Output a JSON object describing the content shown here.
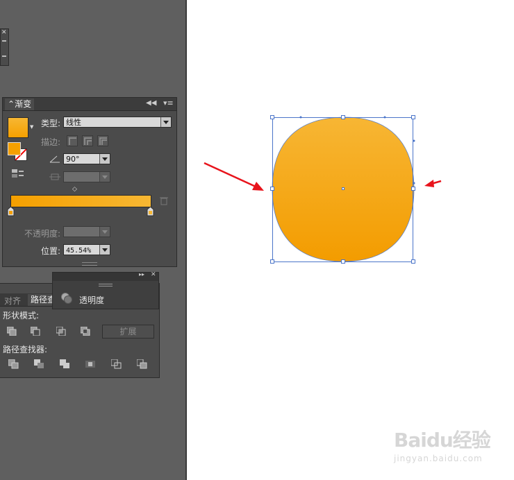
{
  "gradient_panel": {
    "tab": "渐变",
    "type_label": "类型:",
    "type_value": "线性",
    "stroke_label": "描边:",
    "angle_value": "90°",
    "opacity_label": "不透明度:",
    "location_label": "位置:",
    "location_value": "45.54%",
    "gradient_colors": [
      "#f5a000",
      "#f7b733"
    ]
  },
  "transparency_panel": {
    "label": "透明度"
  },
  "pathfinder_panel": {
    "tab_align": "对齐",
    "tab_pathfinder": "路径查",
    "shape_modes_label": "形状模式:",
    "expand_button": "扩展",
    "pathfinders_label": "路径查找器:"
  },
  "canvas": {
    "object_colors": {
      "top": "#f7b634",
      "bottom": "#f39c00"
    }
  },
  "watermark": {
    "brand": "Baidu经验",
    "url": "jingyan.baidu.com"
  }
}
